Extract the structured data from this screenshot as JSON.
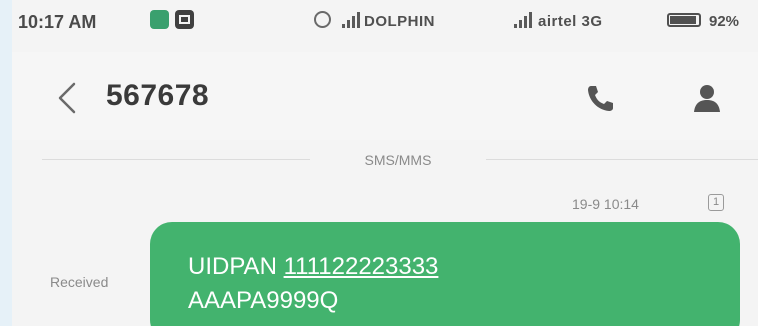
{
  "status_bar": {
    "time": "10:17 AM",
    "carrier_1": "DOLPHIN",
    "carrier_2": "airtel 3G",
    "battery_percent": "92%",
    "battery_level": 0.92
  },
  "header": {
    "title": "567678",
    "back_icon": "chevron-left-icon",
    "call_icon": "phone-icon",
    "contact_icon": "person-icon"
  },
  "conversation": {
    "divider_label": "SMS/MMS",
    "timestamp": "19-9 10:14",
    "sim_label": "1",
    "received_label": "Received",
    "message": {
      "prefix": "UIDPAN ",
      "number": "111122223333",
      "line2": "AAAPA9999Q"
    }
  },
  "colors": {
    "bubble": "#43b36e",
    "background": "#f4f4f4"
  }
}
